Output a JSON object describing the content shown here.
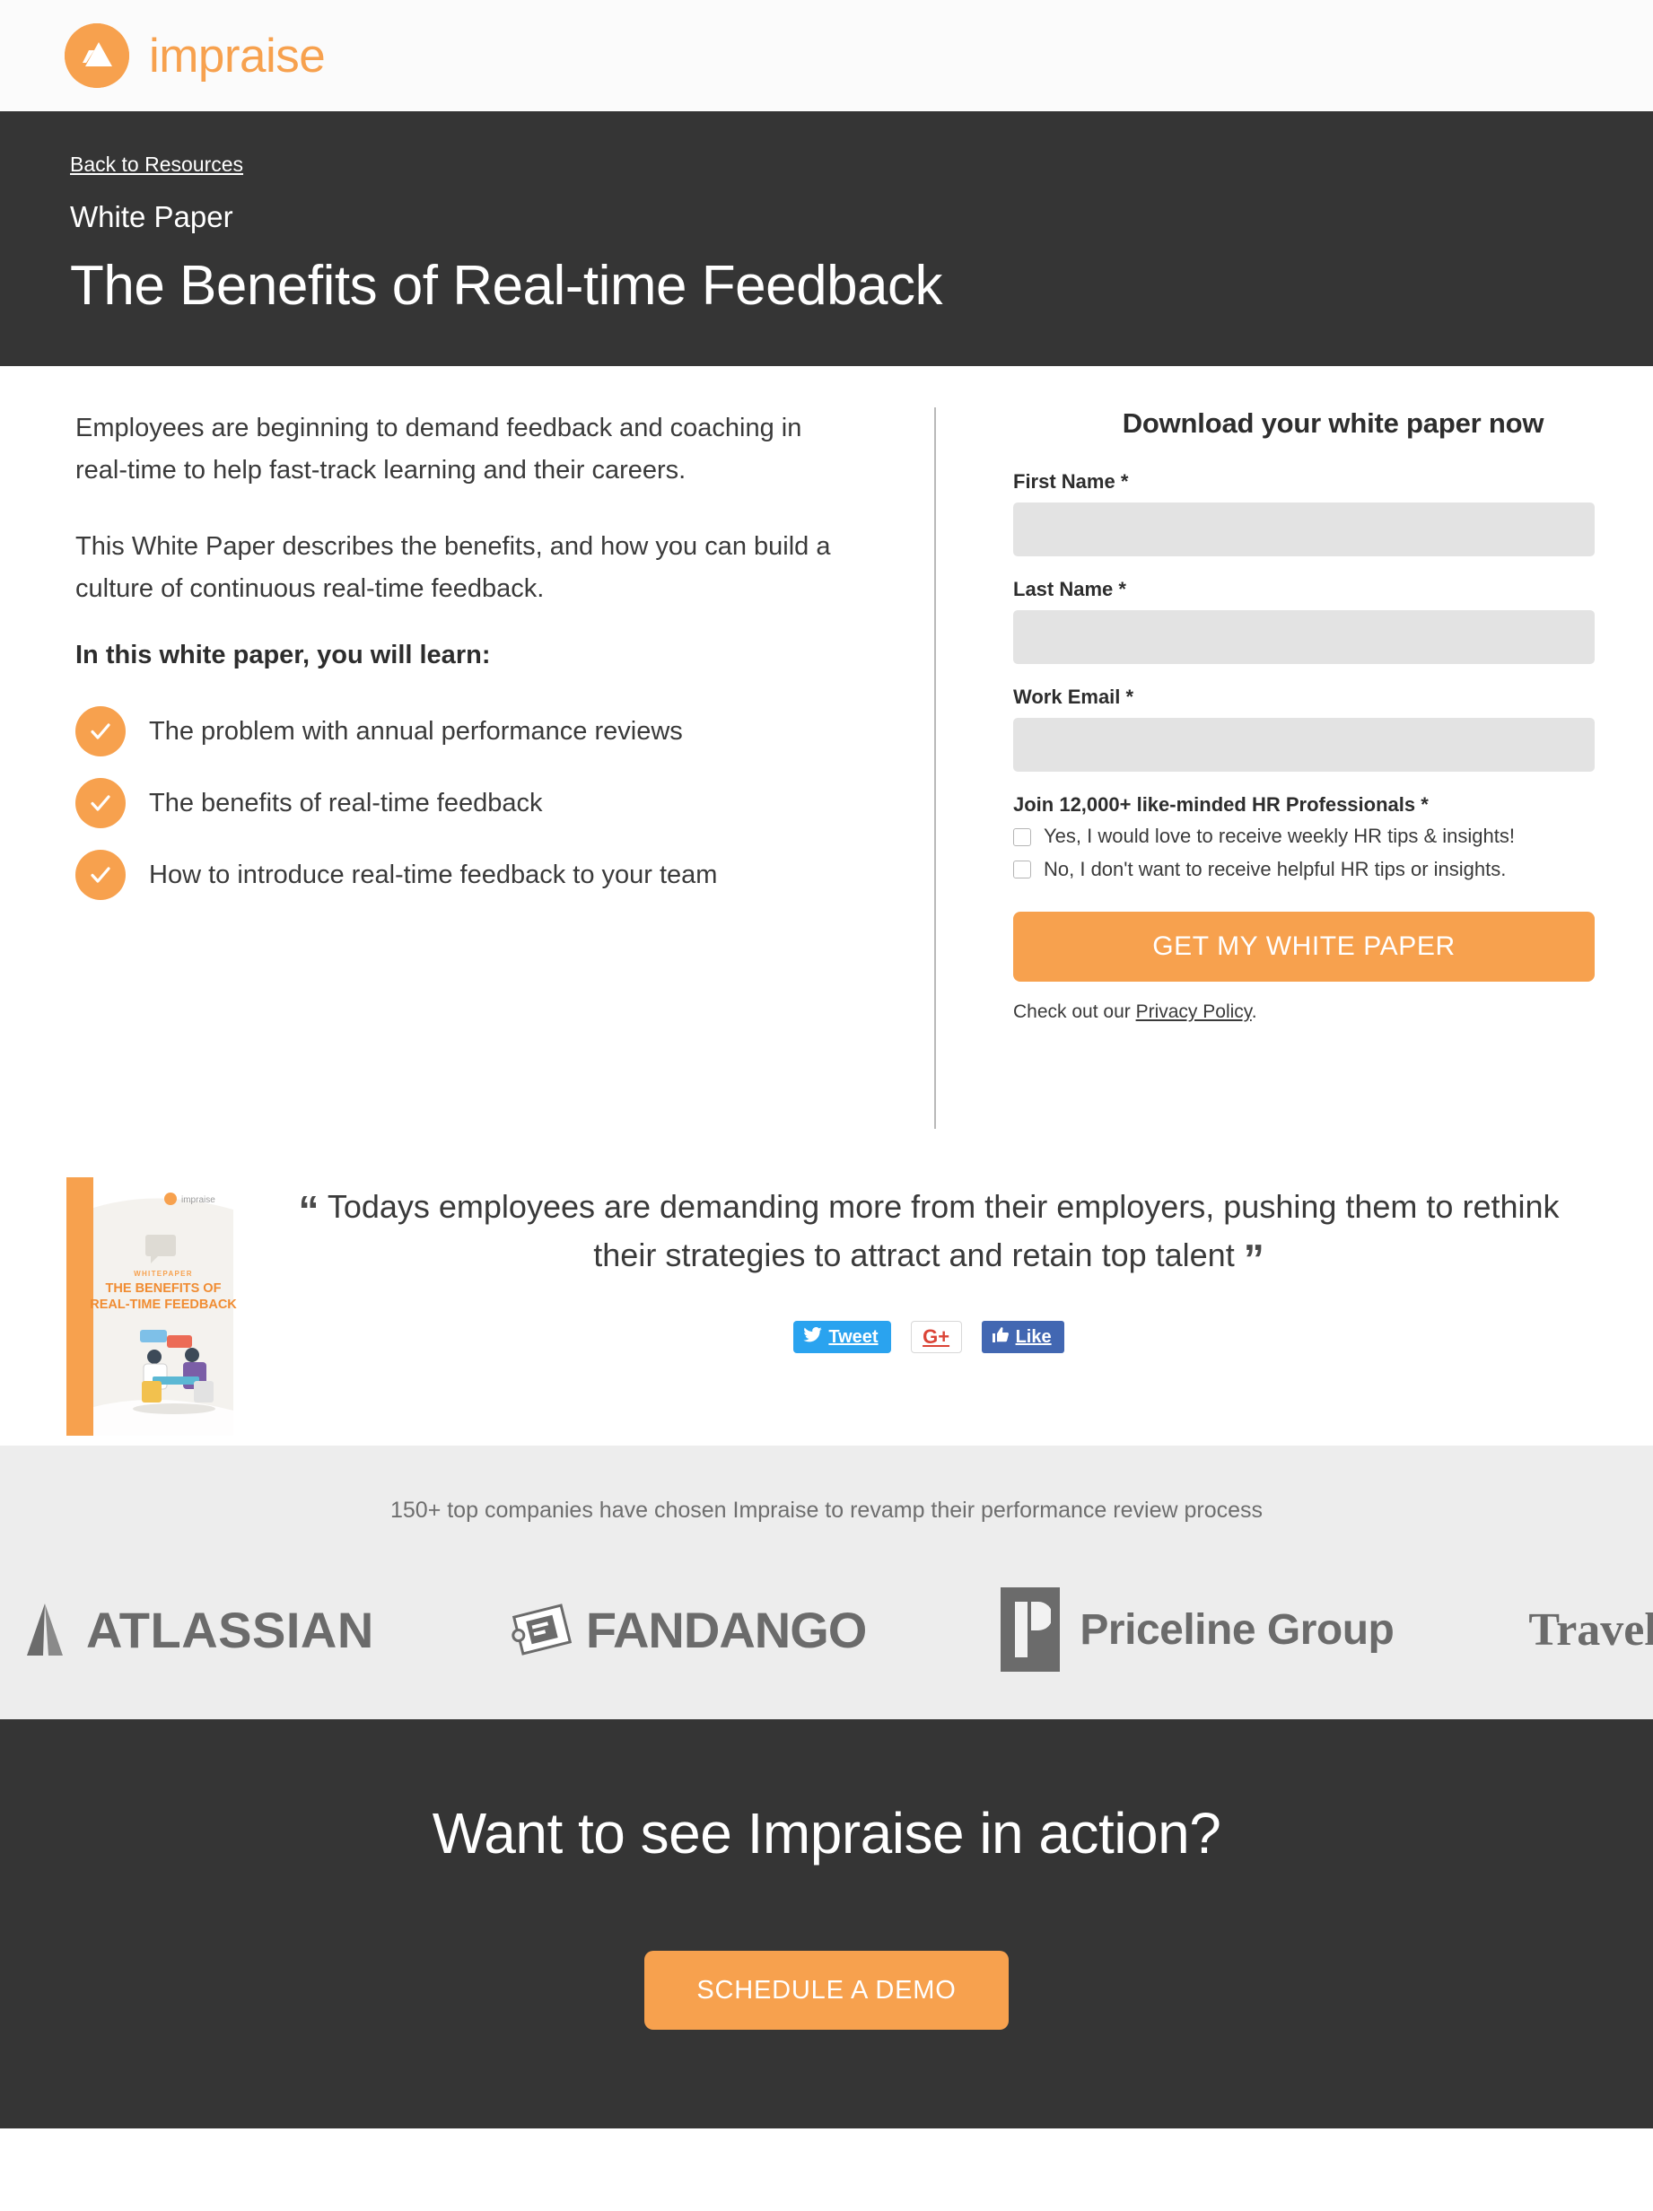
{
  "brand": {
    "name": "impraise",
    "logo_icon": "impraise-triangle-logo",
    "color": "#F7A14E"
  },
  "hero": {
    "back_link": "Back to Resources",
    "kicker": "White Paper",
    "title": "The Benefits of Real-time Feedback",
    "background": "#353535"
  },
  "intro": {
    "paragraph1": "Employees are beginning to demand feedback and coaching in real-time to help fast-track learning and their careers.",
    "paragraph2": "This White Paper describes the benefits, and how you can build a culture of continuous real-time feedback.",
    "learn_heading": "In this white paper, you will learn:",
    "bullets": [
      "The problem with annual performance reviews",
      "The benefits of real-time feedback",
      "How to introduce real-time feedback to your team"
    ]
  },
  "form": {
    "title": "Download your white paper now",
    "fields": [
      {
        "label": "First Name *",
        "value": "",
        "placeholder": ""
      },
      {
        "label": "Last Name *",
        "value": "",
        "placeholder": ""
      },
      {
        "label": "Work Email *",
        "value": "",
        "placeholder": ""
      }
    ],
    "optin_heading": "Join 12,000+ like-minded HR Professionals *",
    "optin_options": [
      {
        "label": "Yes, I would love to receive weekly HR tips & insights!",
        "checked": false
      },
      {
        "label": "No, I don't want to receive helpful HR tips or insights.",
        "checked": false
      }
    ],
    "submit_label": "GET MY WHITE PAPER",
    "privacy_prefix": "Check out our ",
    "privacy_link": "Privacy Policy",
    "privacy_suffix": "."
  },
  "book": {
    "kicker": "WHITEPAPER",
    "title_line1": "THE BENEFITS OF",
    "title_line2": "REAL-TIME FEEDBACK",
    "brand": "impraise"
  },
  "quote": {
    "open_mark": "“",
    "close_mark": "”",
    "text": "Todays employees are demanding more from their employers, pushing them to rethink their strategies to attract and retain top talent"
  },
  "social": {
    "tweet_label": "Tweet",
    "gplus_label": "G+",
    "like_label": "Like"
  },
  "logos": {
    "caption": "150+ top companies have chosen Impraise to revamp their performance review process",
    "items": [
      {
        "name": "ATLASSIAN"
      },
      {
        "name": "FANDANGO"
      },
      {
        "name": "Priceline Group"
      },
      {
        "name": "TravelBird"
      }
    ]
  },
  "bottom_cta": {
    "title": "Want to see Impraise in action?",
    "button_label": "SCHEDULE A DEMO"
  }
}
